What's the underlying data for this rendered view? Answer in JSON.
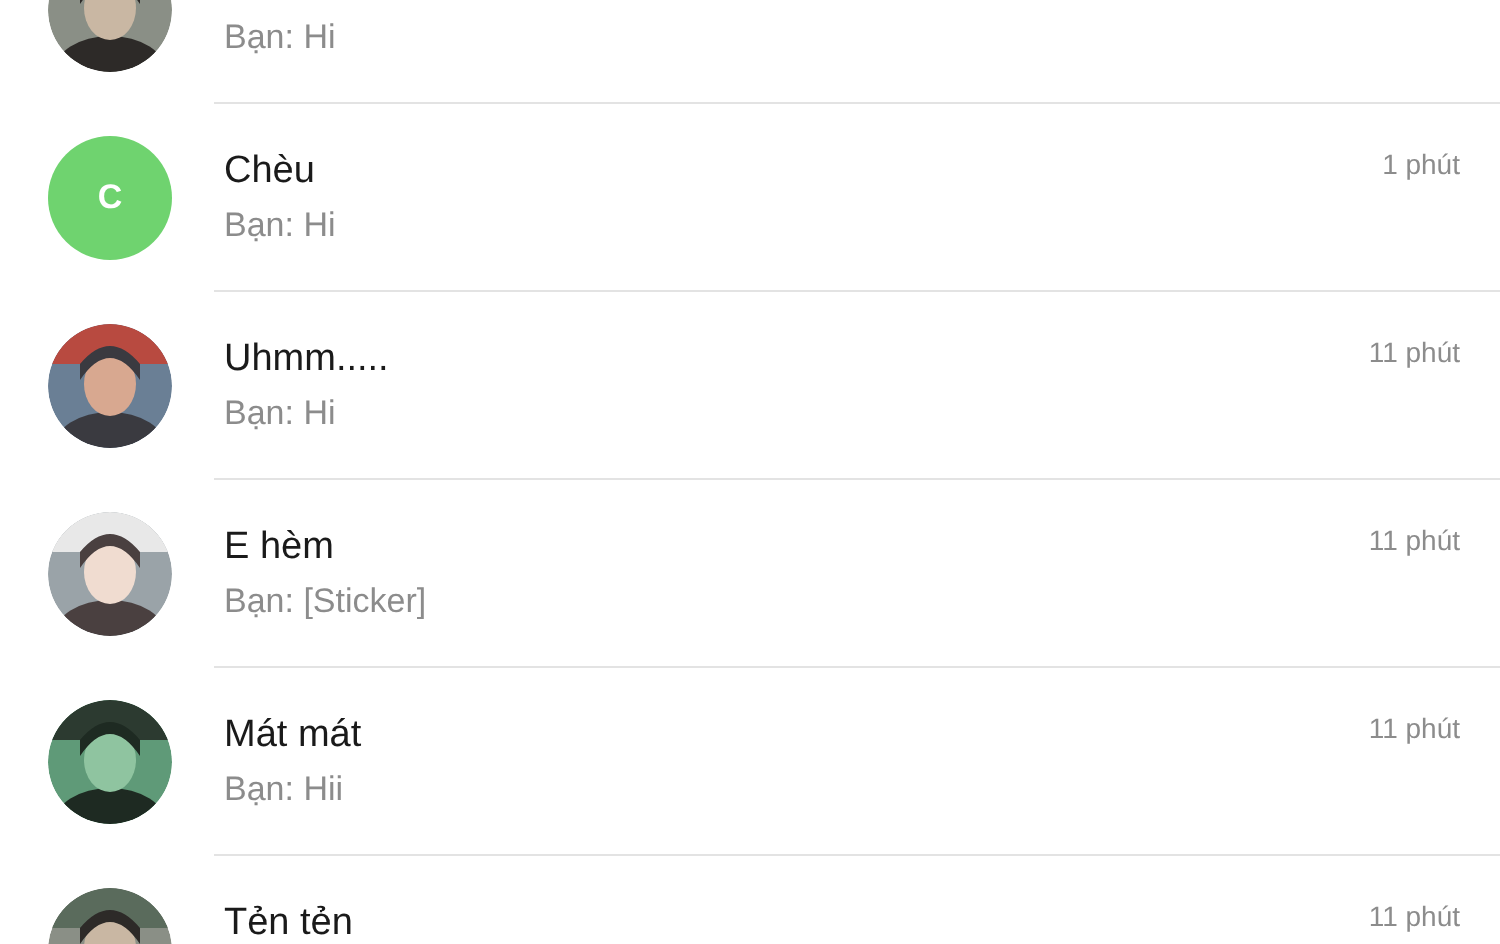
{
  "conversations": [
    {
      "preview": "Bạn: Hi"
    },
    {
      "avatar": {
        "kind": "letter",
        "letter": "C",
        "color": "#6fd36f"
      },
      "name": "Chèu",
      "preview": "Bạn: Hi",
      "time": "1 phút"
    },
    {
      "name": "Uhmm.....",
      "preview": "Bạn: Hi",
      "time": "11 phút"
    },
    {
      "name": "E hèm",
      "preview": "Bạn: [Sticker]",
      "time": "11 phút"
    },
    {
      "name": "Mát mát",
      "preview": "Bạn: Hii",
      "time": "11 phút"
    },
    {
      "name": "Tẻn tẻn",
      "time": "11 phút"
    }
  ]
}
